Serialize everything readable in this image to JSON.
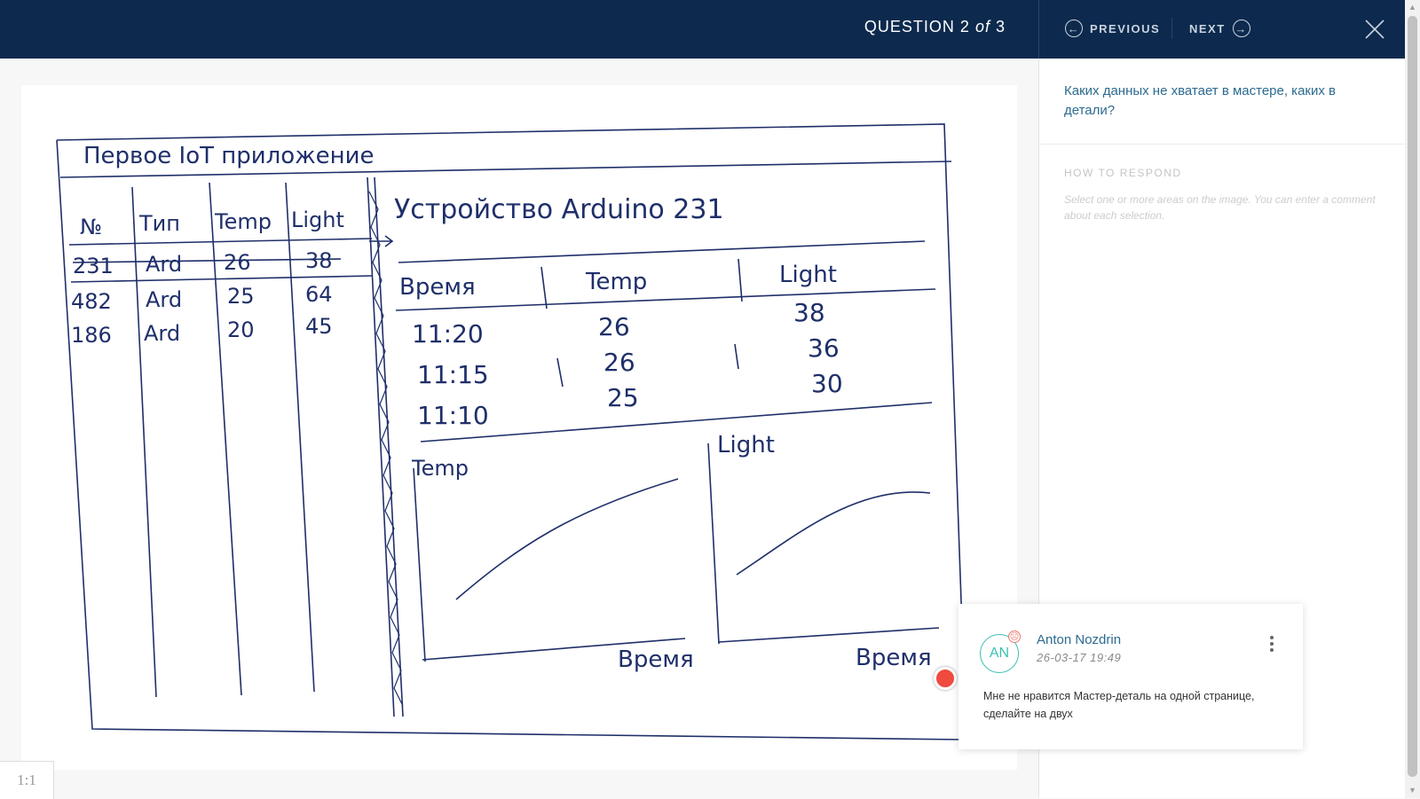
{
  "header": {
    "question_prefix": "QUESTION",
    "question_num": "2",
    "question_of": "of",
    "question_total": "3",
    "previous_label": "PREVIOUS",
    "next_label": "NEXT"
  },
  "sketch": {
    "title": "Первое IoT приложение",
    "list_headers": [
      "№",
      "Тип",
      "Temp",
      "Light"
    ],
    "list_rows": [
      [
        "231",
        "Ard",
        "26",
        "38"
      ],
      [
        "482",
        "Ard",
        "25",
        "64"
      ],
      [
        "186",
        "Ard",
        "20",
        "45"
      ]
    ],
    "detail_title": "Устройство Arduino 231",
    "detail_headers": [
      "Время",
      "Temp",
      "Light"
    ],
    "detail_rows": [
      [
        "11:20",
        "26",
        "38"
      ],
      [
        "11:15",
        "26",
        "36"
      ],
      [
        "11:10",
        "25",
        "30"
      ]
    ],
    "chart1_ylabel": "Temp",
    "chart1_xlabel": "Время",
    "chart2_ylabel": "Light",
    "chart2_xlabel": "Время"
  },
  "panel": {
    "question": "Каких данных не хватает в мастере, каких в детали?",
    "howto_title": "HOW TO RESPOND",
    "howto_text": "Select one or more areas on the image. You can enter a comment about each selection."
  },
  "comment": {
    "initials": "AN",
    "author": "Anton Nozdrin",
    "time": "26-03-17 19:49",
    "text": "Мне не нравится Мастер-деталь на одной странице, сделайте на двух",
    "reaction_icon": "sad-face-icon"
  },
  "zoom": {
    "label": "1:1"
  },
  "colors": {
    "header_bg": "#0d2a4e",
    "ink": "#1f2f6a",
    "accent": "#2b6a8f",
    "avatar": "#3bbfb2",
    "marker": "#ef4b3f"
  }
}
